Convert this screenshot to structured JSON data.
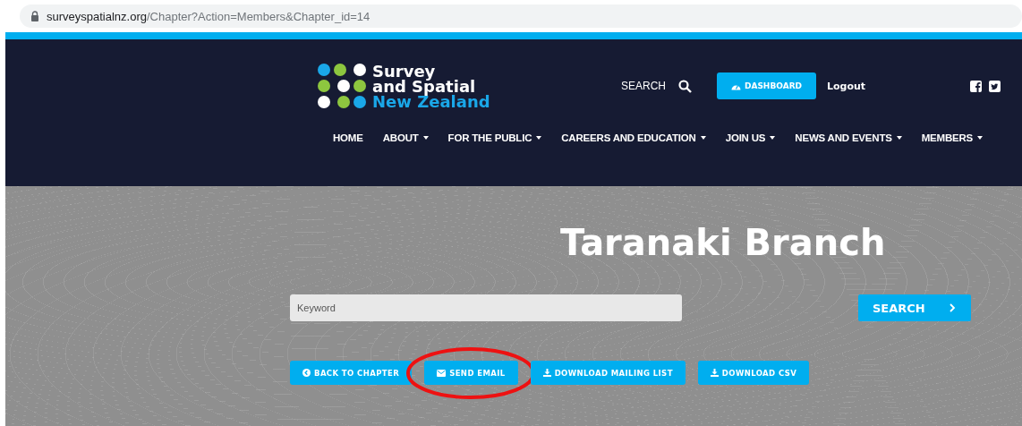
{
  "address_bar": {
    "domain": "surveyspatialnz.org",
    "path": "/Chapter?Action=Members&Chapter_id=14"
  },
  "header": {
    "logo_lines": [
      {
        "text": "Survey",
        "color": "#ffffff"
      },
      {
        "text": "and Spatial",
        "color": "#ffffff"
      },
      {
        "text": "New Zealand",
        "color": "#1aa7e8"
      }
    ],
    "search_label": "SEARCH",
    "dashboard_button": "DASHBOARD",
    "logout": "Logout",
    "nav": [
      {
        "label": "HOME",
        "dropdown": false
      },
      {
        "label": "ABOUT",
        "dropdown": true
      },
      {
        "label": "FOR THE PUBLIC",
        "dropdown": true
      },
      {
        "label": "CAREERS AND EDUCATION",
        "dropdown": true
      },
      {
        "label": "JOIN US",
        "dropdown": true
      },
      {
        "label": "NEWS AND EVENTS",
        "dropdown": true
      },
      {
        "label": "MEMBERS",
        "dropdown": true
      }
    ]
  },
  "hero": {
    "title": "Taranaki Branch",
    "search": {
      "placeholder": "Keyword",
      "button": "SEARCH"
    },
    "actions": [
      {
        "label": "BACK TO CHAPTER",
        "kind": "back",
        "highlighted": false
      },
      {
        "label": "SEND EMAIL",
        "kind": "email",
        "highlighted": true
      },
      {
        "label": "DOWNLOAD MAILING LIST",
        "kind": "download",
        "highlighted": false
      },
      {
        "label": "DOWNLOAD CSV",
        "kind": "download",
        "highlighted": false
      }
    ]
  }
}
